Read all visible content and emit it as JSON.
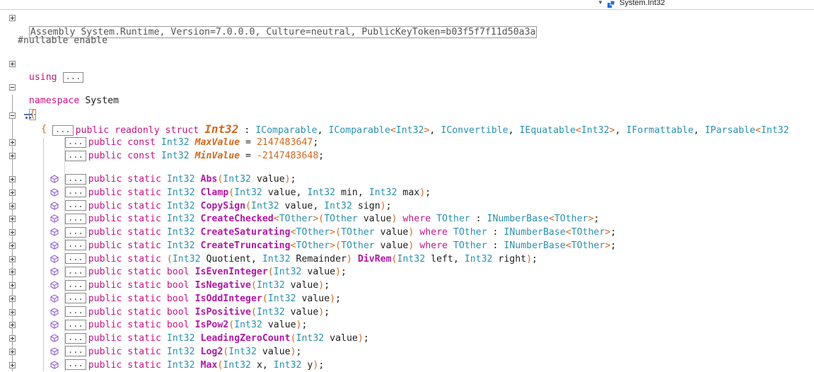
{
  "header": {
    "member_dropdown_value": "System.Int32"
  },
  "code": {
    "assembly": "Assembly System.Runtime, Version=7.0.0.0, Culture=neutral, PublicKeyToken=b03f5f7f11d50a3a",
    "nullable": "#nullable enable",
    "using_kw": "using",
    "collapsed_marker": "...",
    "namespace_kw": "namespace",
    "namespace_name": "System",
    "open_brace": "{",
    "struct_decl": {
      "modifiers": "public readonly struct",
      "name": "Int32",
      "colon": ":",
      "interfaces": [
        {
          "name": "IComparable"
        },
        {
          "name": "IComparable",
          "type_arg": "Int32"
        },
        {
          "name": "IConvertible"
        },
        {
          "name": "IEquatable",
          "type_arg": "Int32"
        },
        {
          "name": "IFormattable"
        },
        {
          "name": "IParsable",
          "type_arg": "Int32"
        }
      ]
    },
    "constants": [
      {
        "modifiers": "public const",
        "type": "Int32",
        "name": "MaxValue",
        "value": "2147483647"
      },
      {
        "modifiers": "public const",
        "type": "Int32",
        "name": "MinValue",
        "value": "-2147483648"
      }
    ],
    "methods": [
      {
        "mods": "public static",
        "ret": "Int32",
        "name": "Abs",
        "generic": "",
        "params": "Int32 value",
        "where": ""
      },
      {
        "mods": "public static",
        "ret": "Int32",
        "name": "Clamp",
        "generic": "",
        "params": "Int32 value, Int32 min, Int32 max",
        "where": ""
      },
      {
        "mods": "public static",
        "ret": "Int32",
        "name": "CopySign",
        "generic": "",
        "params": "Int32 value, Int32 sign",
        "where": ""
      },
      {
        "mods": "public static",
        "ret": "Int32",
        "name": "CreateChecked",
        "generic": "TOther",
        "params": "TOther value",
        "where": "where TOther : INumberBase<TOther>"
      },
      {
        "mods": "public static",
        "ret": "Int32",
        "name": "CreateSaturating",
        "generic": "TOther",
        "params": "TOther value",
        "where": "where TOther : INumberBase<TOther>"
      },
      {
        "mods": "public static",
        "ret": "Int32",
        "name": "CreateTruncating",
        "generic": "TOther",
        "params": "TOther value",
        "where": "where TOther : INumberBase<TOther>"
      },
      {
        "mods": "public static",
        "ret": "(Int32 Quotient, Int32 Remainder)",
        "name": "DivRem",
        "generic": "",
        "params": "Int32 left, Int32 right",
        "where": ""
      },
      {
        "mods": "public static",
        "ret": "bool",
        "name": "IsEvenInteger",
        "generic": "",
        "params": "Int32 value",
        "where": ""
      },
      {
        "mods": "public static",
        "ret": "bool",
        "name": "IsNegative",
        "generic": "",
        "params": "Int32 value",
        "where": ""
      },
      {
        "mods": "public static",
        "ret": "bool",
        "name": "IsOddInteger",
        "generic": "",
        "params": "Int32 value",
        "where": ""
      },
      {
        "mods": "public static",
        "ret": "bool",
        "name": "IsPositive",
        "generic": "",
        "params": "Int32 value",
        "where": ""
      },
      {
        "mods": "public static",
        "ret": "bool",
        "name": "IsPow2",
        "generic": "",
        "params": "Int32 value",
        "where": ""
      },
      {
        "mods": "public static",
        "ret": "Int32",
        "name": "LeadingZeroCount",
        "generic": "",
        "params": "Int32 value",
        "where": ""
      },
      {
        "mods": "public static",
        "ret": "Int32",
        "name": "Log2",
        "generic": "",
        "params": "Int32 value",
        "where": ""
      },
      {
        "mods": "public static",
        "ret": "Int32",
        "name": "Max",
        "generic": "",
        "params": "Int32 x, Int32 y",
        "where": ""
      }
    ]
  },
  "colors": {
    "keyword": "#c71585",
    "type": "#2b91af",
    "method": "#b118a4",
    "constant": "#d2691e"
  }
}
